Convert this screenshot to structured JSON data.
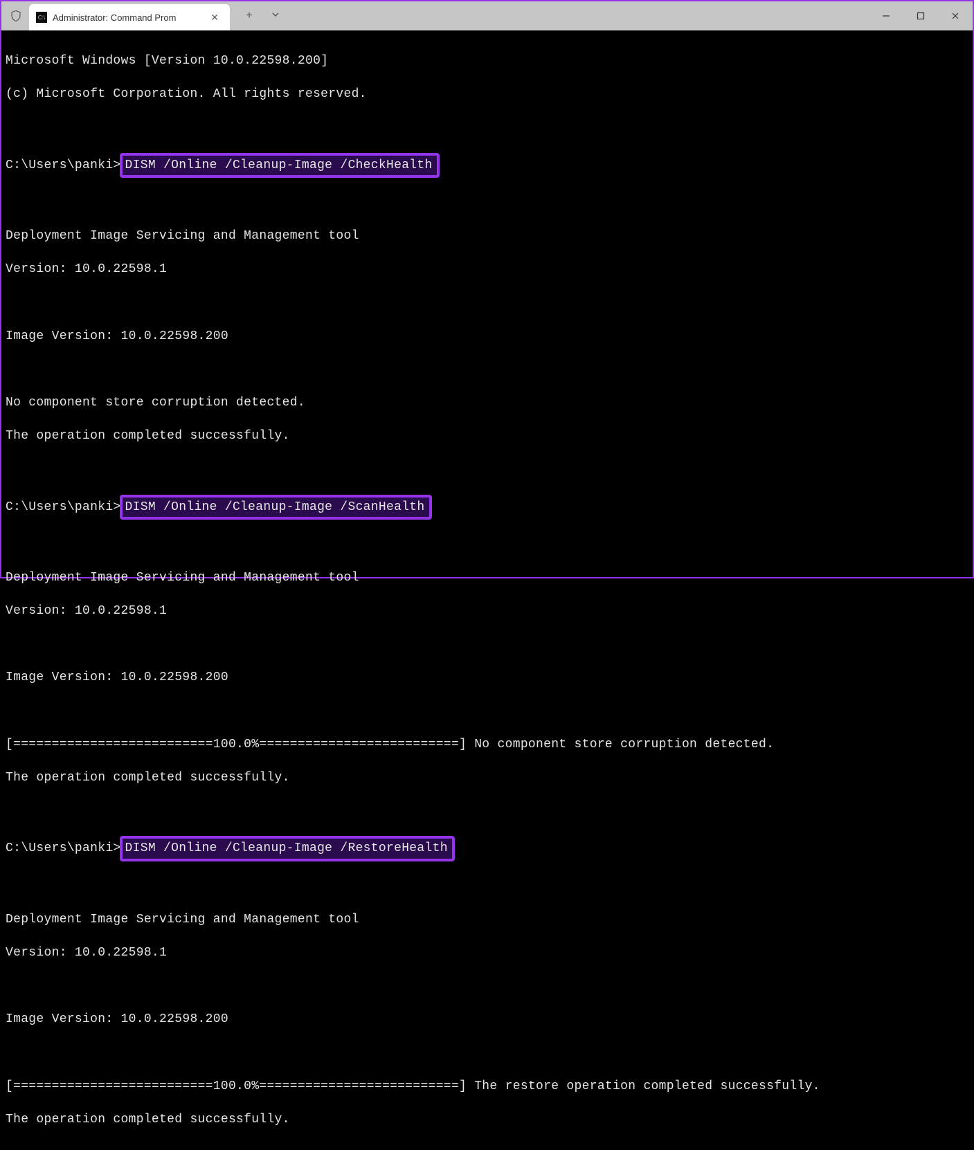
{
  "window": {
    "tab_title": "Administrator: Command Prom",
    "tab_icon_text": "C:\\"
  },
  "terminal": {
    "lines": [
      "Microsoft Windows [Version 10.0.22598.200]",
      "(c) Microsoft Corporation. All rights reserved.",
      "",
      "Deployment Image Servicing and Management tool",
      "Version: 10.0.22598.1",
      "",
      "Image Version: 10.0.22598.200",
      "",
      "No component store corruption detected.",
      "The operation completed successfully.",
      "",
      "Deployment Image Servicing and Management tool",
      "Version: 10.0.22598.1",
      "",
      "Image Version: 10.0.22598.200",
      "",
      "[==========================100.0%==========================] No component store corruption detected.",
      "The operation completed successfully.",
      "",
      "Deployment Image Servicing and Management tool",
      "Version: 10.0.22598.1",
      "",
      "Image Version: 10.0.22598.200",
      "",
      "[==========================100.0%==========================] The restore operation completed successfully.",
      "The operation completed successfully."
    ],
    "prompts": [
      {
        "prefix": "C:\\Users\\panki>",
        "command": "DISM /Online /Cleanup-Image /CheckHealth"
      },
      {
        "prefix": "C:\\Users\\panki>",
        "command": "DISM /Online /Cleanup-Image /ScanHealth"
      },
      {
        "prefix": "C:\\Users\\panki>",
        "command": "DISM /Online /Cleanup-Image /RestoreHealth"
      }
    ]
  }
}
